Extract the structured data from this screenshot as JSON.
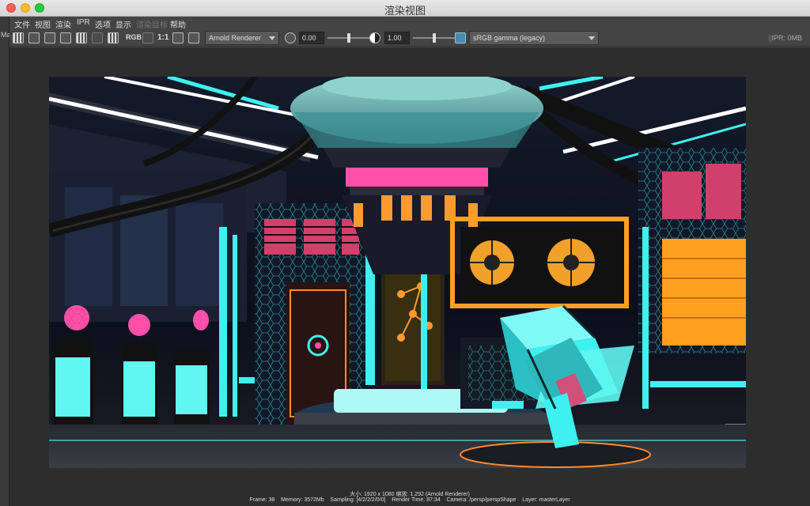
{
  "window": {
    "title": "渲染视图"
  },
  "left_strip": {
    "label": "Ma"
  },
  "menubar": {
    "items": [
      {
        "label": "文件",
        "enabled": true
      },
      {
        "label": "视图",
        "enabled": true
      },
      {
        "label": "渲染",
        "enabled": true
      },
      {
        "label": "IPR",
        "enabled": true
      },
      {
        "label": "选项",
        "enabled": true
      },
      {
        "label": "显示",
        "enabled": true
      },
      {
        "label": "渲染目标",
        "enabled": false
      },
      {
        "label": "帮助",
        "enabled": true
      }
    ]
  },
  "toolbar": {
    "rgb_label": "RGB",
    "ratio_label": "1:1",
    "renderer": "Arnold Renderer",
    "exposure_value": "0.00",
    "gamma_value": "1.00",
    "exposure_level": 0.5,
    "gamma_level": 0.5,
    "color_space": "sRGB gamma (legacy)",
    "ipr_memory": "IPR: 0MB"
  },
  "status": {
    "line1": "大小: 1920 x 1080  缩放: 1.292     (Arnold Renderer)",
    "frame": "Frame: 38",
    "memory": "Memory: 3572Mb",
    "sampling": "Sampling: [4/2/2/2/0/0]",
    "render_time": "Render Time: 87:34",
    "camera": "Camera: /persp/perspShape",
    "layer": "Layer: masterLayer"
  },
  "colors": {
    "neon_cyan": "#3ff0f0",
    "neon_pink": "#ff4fa8",
    "neon_orange": "#ffa020",
    "dark_bg": "#0a0d16"
  }
}
